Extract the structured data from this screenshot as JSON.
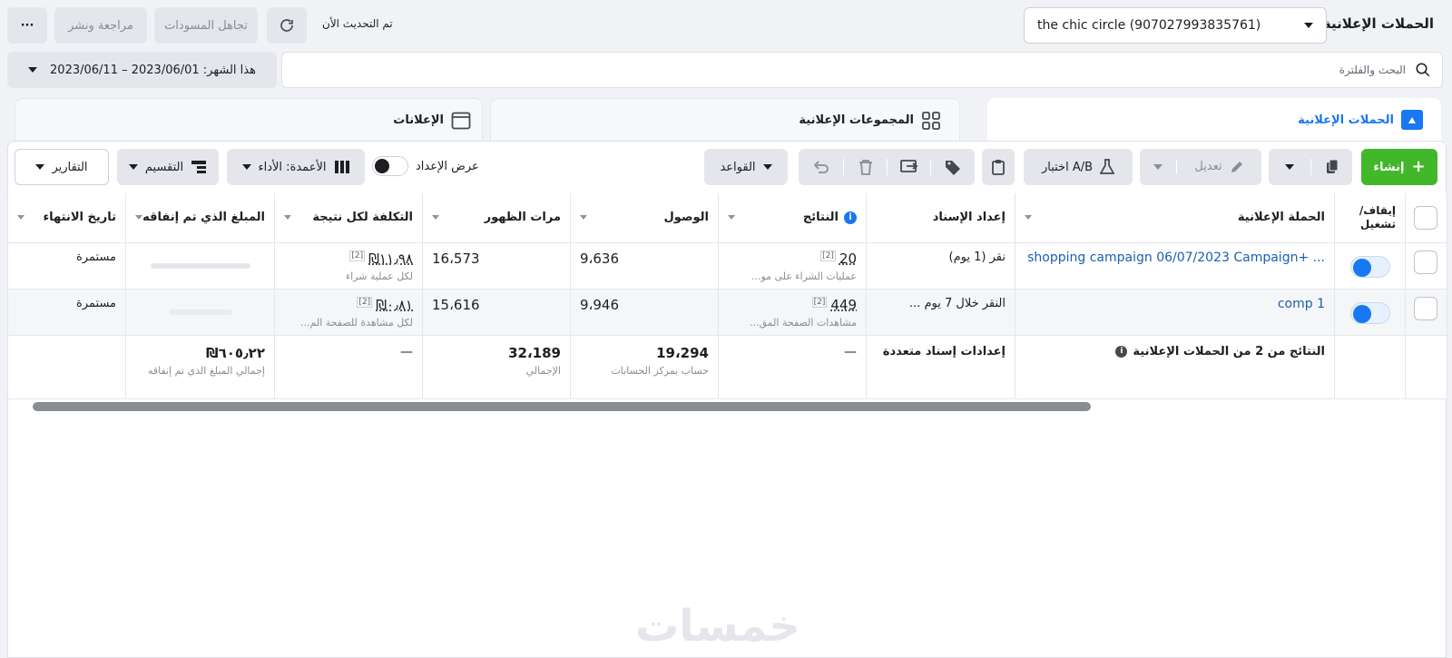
{
  "header": {
    "title": "الحملات الإعلانية",
    "account": "the chic circle (907027993835761)",
    "updated_label": "تم التحديث الأن",
    "discard_drafts": "تجاهل المسودات",
    "review_publish": "مراجعة ونشر",
    "more": "···"
  },
  "search": {
    "placeholder": "البحث والفلترة"
  },
  "date_range": {
    "label": "هذا الشهر: 2023/06/01 – 2023/06/11"
  },
  "tabs": [
    {
      "label": "الحملات الإعلانية"
    },
    {
      "label": "المجموعات الإعلانية"
    },
    {
      "label": "الإعلانات"
    }
  ],
  "toolbar": {
    "create": "إنشاء",
    "edit": "تعديل",
    "ab_test": "اختبار A/B",
    "rules": "القواعد",
    "view_setup": "عرض الإعداد",
    "columns": "الأعمدة: الأداء",
    "breakdown": "التقسيم",
    "reports": "التقارير"
  },
  "table": {
    "headers": {
      "off_on": "إيقاف/ تشغيل",
      "campaign": "الحملة الإعلانية",
      "attribution": "إعداد الإسناد",
      "results": "النتائج",
      "reach": "الوصول",
      "impressions": "مرات الظهور",
      "cost_per_result": "التكلفة لكل نتيجة",
      "amount_spent": "المبلغ الذي تم إنفاقه",
      "end_date": "تاريخ الانتهاء"
    },
    "rows": [
      {
        "campaign": "shopping campaign 06/07/2023 Campaign+ ...",
        "attribution": "نقر (1 يوم)",
        "results": "20",
        "results_sub": "عمليات الشراء على مو...",
        "results_note": "[2]",
        "reach": "9،636",
        "impressions": "16،573",
        "cost": "‏١١٫٩٨‏₪",
        "cost_sub": "لكل عملية شراء",
        "cost_note": "[2]",
        "end_date": "مستمرة"
      },
      {
        "campaign": "comp 1",
        "attribution": "النقر خلال 7 يوم ...",
        "results": "449",
        "results_sub": "مشاهدات الصفحة المق...",
        "results_note": "[2]",
        "reach": "9،946",
        "impressions": "15،616",
        "cost": "‏٠٫٨١‏₪",
        "cost_sub": "لكل مشاهدة للصفحة الم...",
        "cost_note": "[2]",
        "end_date": "مستمرة"
      }
    ],
    "summary": {
      "campaign": "النتائج من 2 من الحملات الإعلانية",
      "attribution": "إعدادات إسناد متعددة",
      "results": "—",
      "reach": "19،294",
      "reach_sub": "حساب بمركز الحسابات",
      "impressions": "32،189",
      "impressions_sub": "الإجمالي",
      "cost": "—",
      "spent": "‏٦٠٥٫٢٢‏₪",
      "spent_sub": "إجمالي المبلغ الذي تم إنفاقه"
    }
  },
  "watermark": "خمسات"
}
